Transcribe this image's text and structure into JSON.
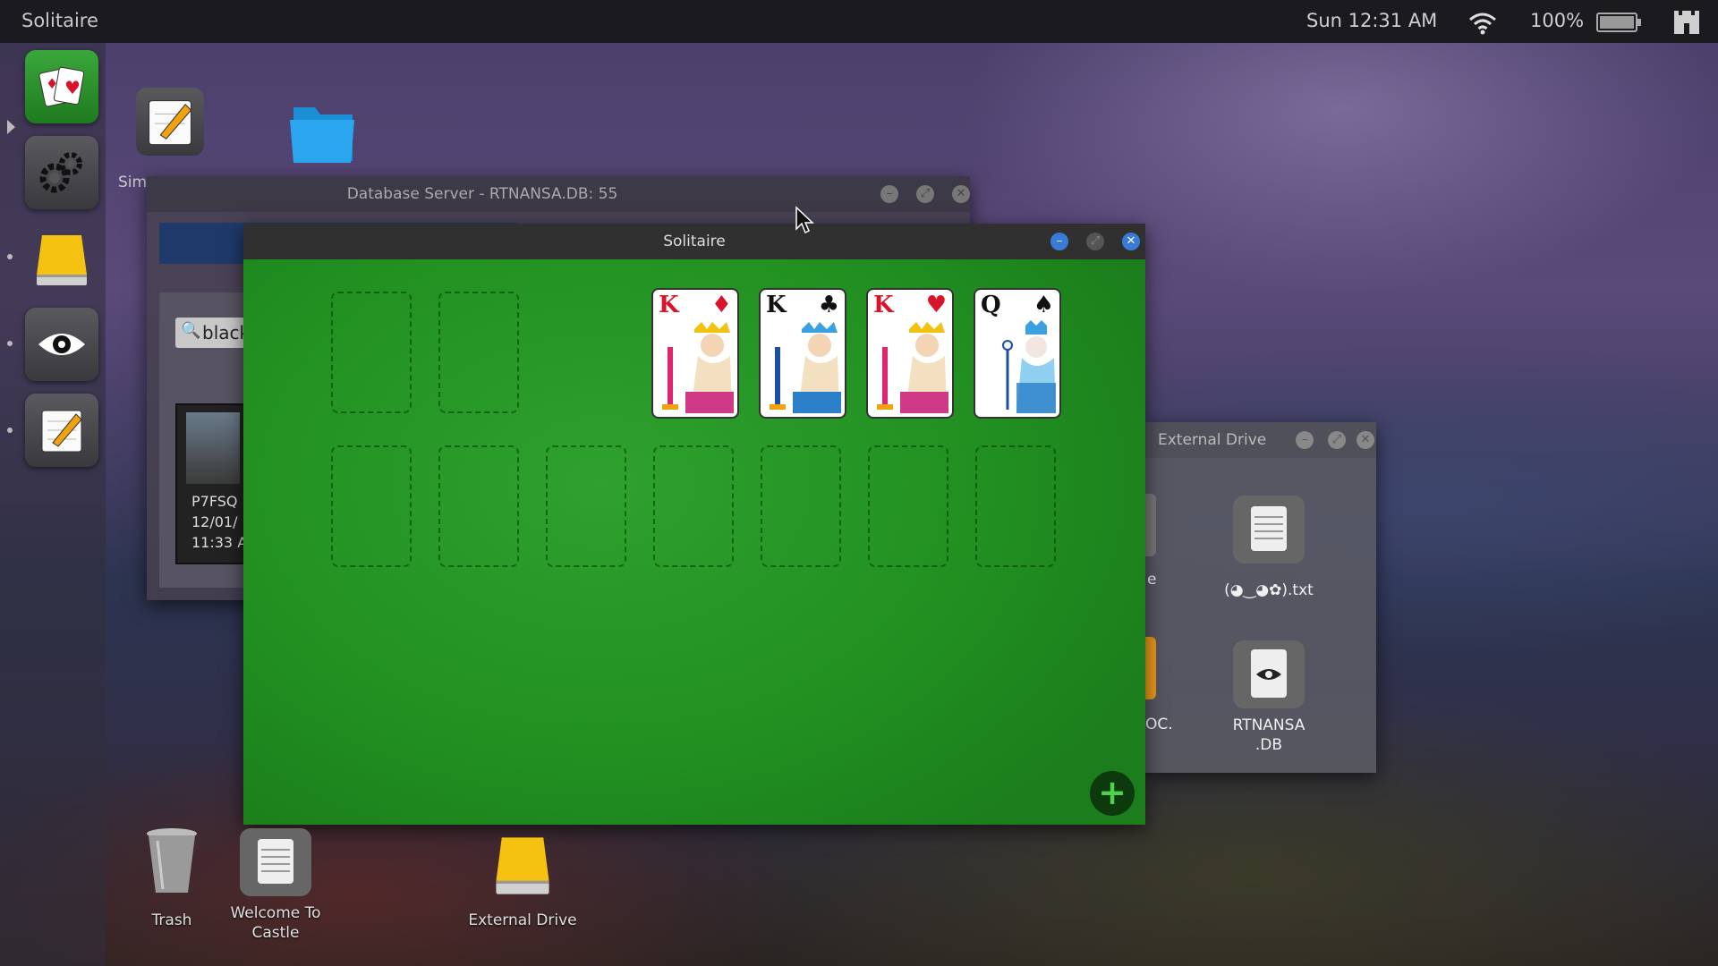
{
  "topbar": {
    "app_title": "Solitaire",
    "clock": "Sun 12:31 AM",
    "battery_percent": "100%",
    "battery_level": 1.0
  },
  "launcher": {
    "items": [
      "solitaire-icon",
      "gear-icon",
      "drive-icon",
      "eye-icon",
      "notepad-icon"
    ]
  },
  "desktop": {
    "partial_label": "Sim",
    "icons": [
      {
        "label": "Trash"
      },
      {
        "label": "Welcome To Castle"
      },
      {
        "label": "External Drive"
      }
    ]
  },
  "db_window": {
    "title": "Database Server - RTNANSA.DB: 55",
    "search_value": "black",
    "record_lines": [
      "P7FSQ",
      "12/01/",
      "11:33 A"
    ]
  },
  "ext_window": {
    "title": "External Drive",
    "partial_labels": [
      "e",
      "OC."
    ],
    "files": [
      {
        "label": "(◕‿◕✿).txt"
      },
      {
        "label": "RTNANSA\n.DB"
      }
    ]
  },
  "solitaire": {
    "title": "Solitaire",
    "foundations": [
      {
        "rank": "K",
        "suit": "♦",
        "color": "#d8132b"
      },
      {
        "rank": "K",
        "suit": "♣",
        "color": "#111111"
      },
      {
        "rank": "K",
        "suit": "♥",
        "color": "#d8132b"
      },
      {
        "rank": "Q",
        "suit": "♠",
        "color": "#111111"
      }
    ],
    "add_label": "+"
  },
  "colors": {
    "felt": "#229322",
    "close_blue": "#3a7bd5"
  }
}
